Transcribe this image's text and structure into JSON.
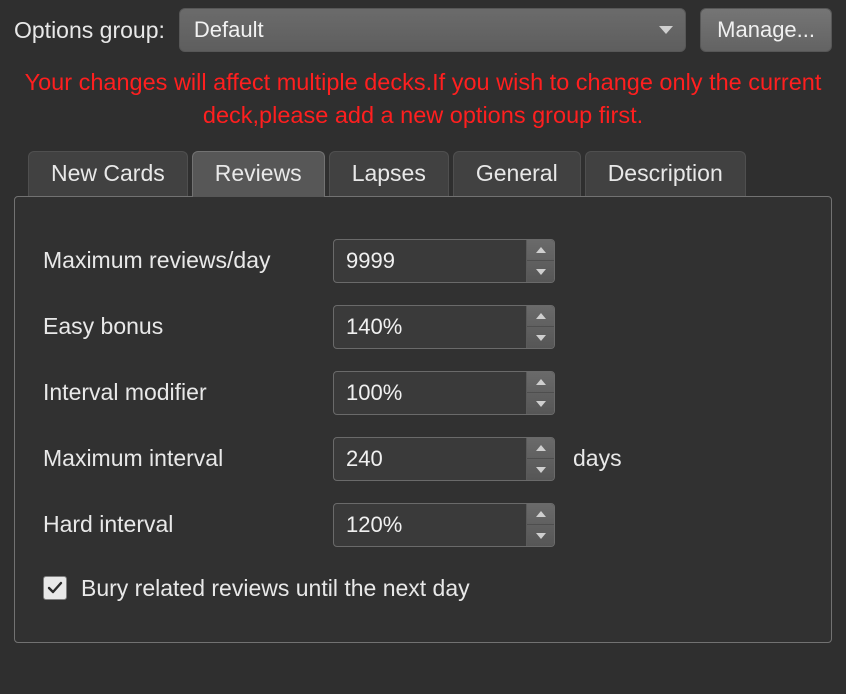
{
  "header": {
    "options_group_label": "Options group:",
    "selected_group": "Default",
    "manage_label": "Manage..."
  },
  "warning_text": "Your changes will affect multiple decks.If you wish to change only the current deck,please add a new options group first.",
  "tabs": {
    "new_cards": "New Cards",
    "reviews": "Reviews",
    "lapses": "Lapses",
    "general": "General",
    "description": "Description"
  },
  "reviews_panel": {
    "max_reviews_label": "Maximum reviews/day",
    "max_reviews_value": "9999",
    "easy_bonus_label": "Easy bonus",
    "easy_bonus_value": "140%",
    "interval_modifier_label": "Interval modifier",
    "interval_modifier_value": "100%",
    "max_interval_label": "Maximum interval",
    "max_interval_value": "240",
    "max_interval_suffix": "days",
    "hard_interval_label": "Hard interval",
    "hard_interval_value": "120%",
    "bury_label": "Bury related reviews until the next day",
    "bury_checked": true
  }
}
